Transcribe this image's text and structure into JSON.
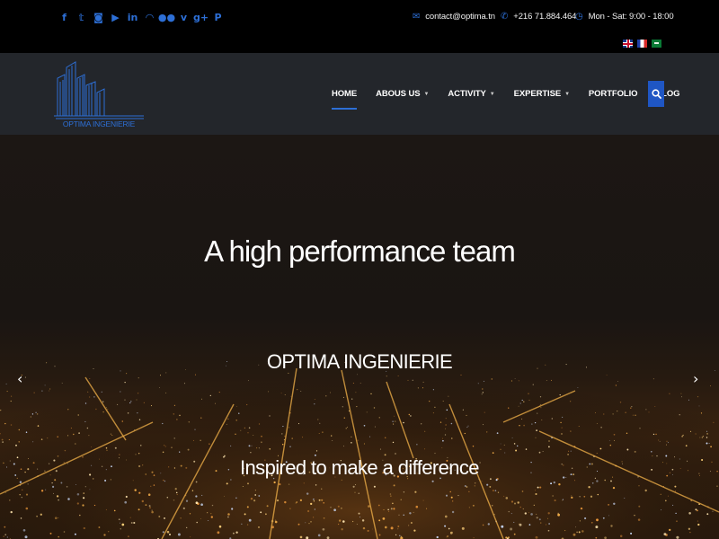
{
  "topbar": {
    "social_icons": [
      "facebook-icon",
      "twitter-icon",
      "instagram-icon",
      "youtube-icon",
      "linkedin-icon",
      "rss-icon",
      "flickr-icon",
      "vimeo-icon",
      "google-plus-icon",
      "pinterest-icon"
    ],
    "social_glyphs": [
      "f",
      "𝕥",
      "◙",
      "▶",
      "in",
      "◠",
      "●●",
      "v",
      "g+",
      "P"
    ],
    "email": "contact@optima.tn",
    "phone": "+216 71.884.464",
    "hours": "Mon - Sat: 9:00 - 18:00",
    "languages": [
      "English",
      "Français",
      "العربية"
    ]
  },
  "header": {
    "logo_text": "OPTIMA INGENIERIE",
    "nav": {
      "home": "HOME",
      "about": "ABOUS US",
      "activity": "ACTIVITY",
      "expertise": "EXPERTISE",
      "portfolio": "PORTFOLIO",
      "blog": "BLOG"
    }
  },
  "hero": {
    "title": "A high performance team",
    "subtitle": "OPTIMA INGENIERIE",
    "tagline": "Inspired to make a difference",
    "prev_glyph": "‹",
    "next_glyph": "›"
  },
  "colors": {
    "accent": "#2d6fd6",
    "topbar_bg": "#000000",
    "header_bg": "#23262b",
    "search_bg": "#1f56c4"
  }
}
